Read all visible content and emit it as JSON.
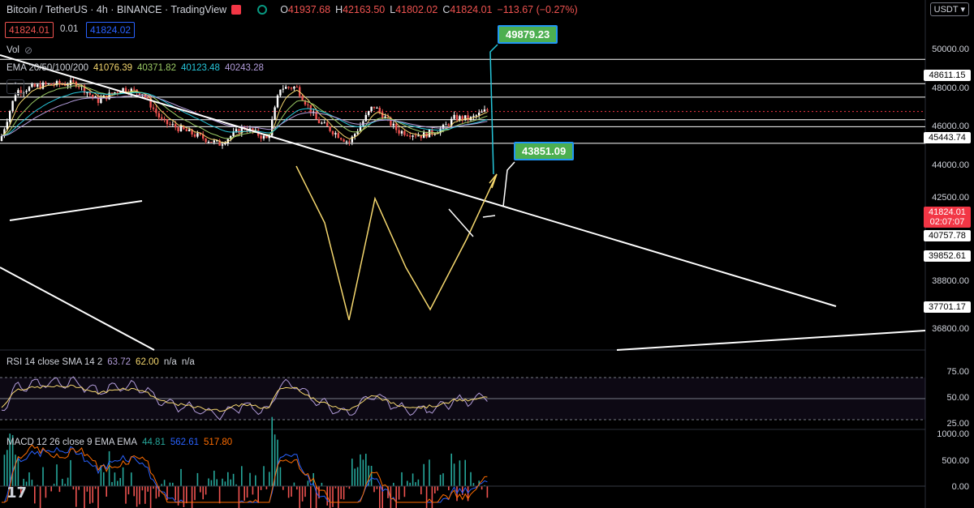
{
  "header": {
    "symbol": "Bitcoin / TetherUS · 4h · BINANCE · TradingView",
    "open_label": "O",
    "open": "41937.68",
    "high_label": "H",
    "high": "42163.50",
    "low_label": "L",
    "low": "41802.02",
    "close_label": "C",
    "close": "41824.01",
    "change": "−113.67 (−0.27%)"
  },
  "quote": {
    "bid": "41824.01",
    "spread": "0.01",
    "ask": "41824.02"
  },
  "volume_label": "Vol",
  "ema": {
    "label": "EMA 20/50/100/200",
    "v20": "41076.39",
    "v50": "40371.82",
    "v100": "40123.48",
    "v200": "40243.28",
    "colors": [
      "#f5d76e",
      "#9ccc65",
      "#26c6da",
      "#b39ddb"
    ]
  },
  "currency": "USDT",
  "price_axis": {
    "ticks": [
      "50000.00",
      "48000.00",
      "46000.00",
      "44000.00",
      "42500.00",
      "38800.00",
      "36800.00"
    ],
    "levels": [
      "48611.15",
      "45443.74",
      "40757.78",
      "39852.61",
      "37701.17"
    ],
    "last_price": "41824.01",
    "countdown": "02:07:07"
  },
  "callouts": {
    "target_high": "49879.23",
    "target_low": "43851.09"
  },
  "rsi": {
    "label": "RSI 14 close SMA 14 2",
    "v1": "63.72",
    "v2": "62.00",
    "v3": "n/a",
    "v4": "n/a",
    "ticks": [
      "75.00",
      "50.00",
      "25.00"
    ]
  },
  "macd": {
    "label": "MACD 12 26 close 9 EMA EMA",
    "hist": "44.81",
    "macd": "562.61",
    "signal": "517.80",
    "ticks": [
      "1000.00",
      "500.00",
      "0.00"
    ]
  },
  "logo": "17"
}
